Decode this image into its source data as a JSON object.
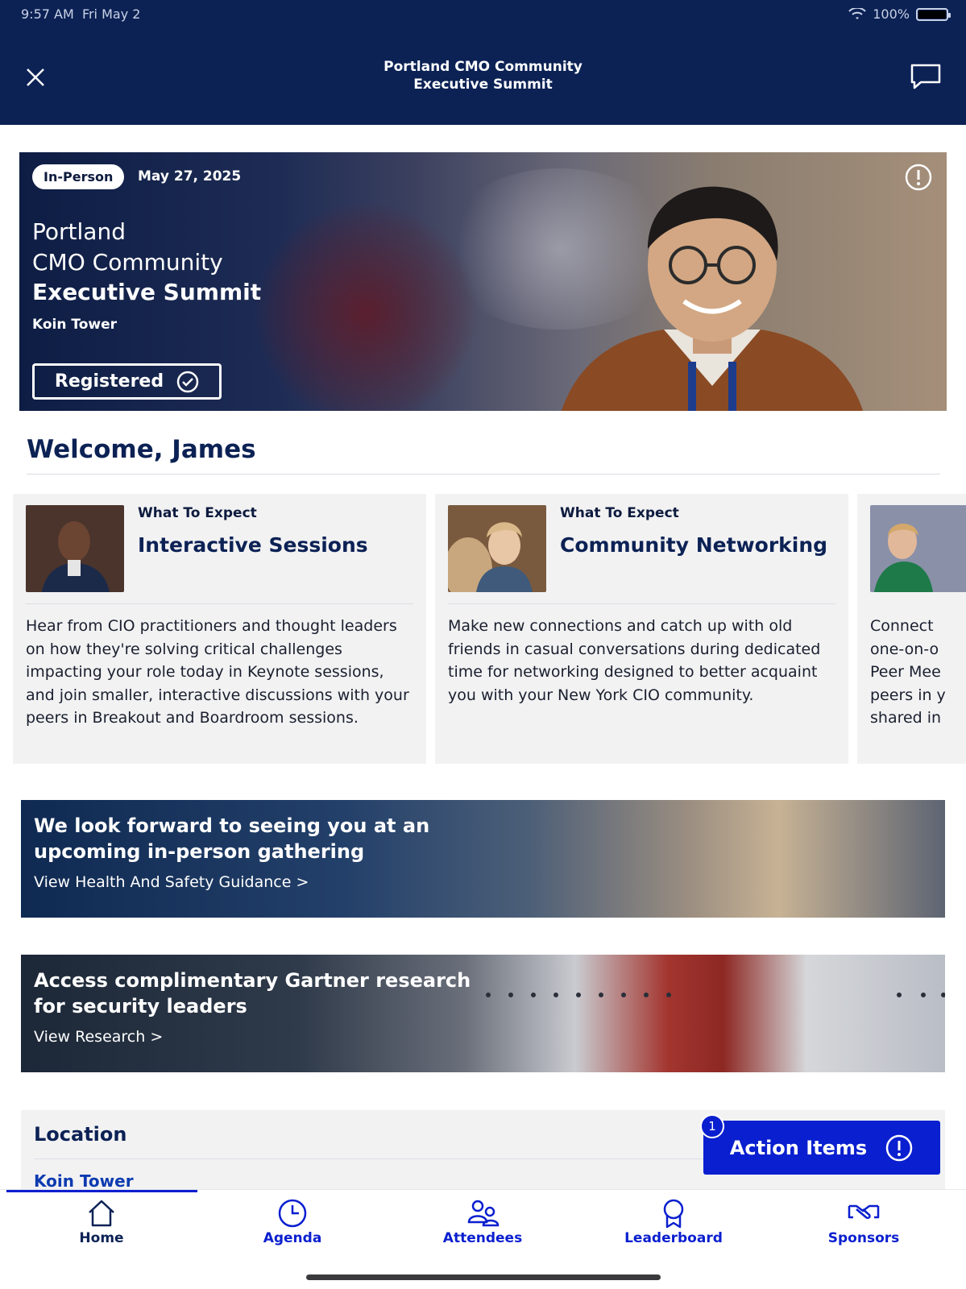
{
  "status_bar": {
    "time": "9:57 AM",
    "date": "Fri May 2",
    "battery": "100%"
  },
  "header": {
    "title_line1": "Portland CMO Community",
    "title_line2": "Executive Summit"
  },
  "hero": {
    "format_chip": "In-Person",
    "date": "May 27, 2025",
    "line1": "Portland",
    "line2": "CMO Community",
    "line3": "Executive Summit",
    "venue": "Koin Tower",
    "registered_label": "Registered"
  },
  "welcome": "Welcome, James",
  "cards": [
    {
      "kicker": "What To Expect",
      "title": "Interactive Sessions",
      "body": "Hear from CIO practitioners and thought leaders on how they're solving critical challenges impacting your role today in Keynote sessions, and join smaller, interactive discussions with your peers in Breakout and Boardroom sessions."
    },
    {
      "kicker": "What To Expect",
      "title": "Community Networking",
      "body": "Make new connections and catch up with old friends in casual conversations during dedicated time for networking designed to better acquaint you with your New York CIO community."
    },
    {
      "kicker": "",
      "title": "",
      "body": "Connect one-on-o Peer Mee peers in y shared in"
    }
  ],
  "banners": [
    {
      "title": "We look forward to seeing you at an upcoming in-person gathering",
      "link": "View Health And Safety Guidance >"
    },
    {
      "title": "Access complimentary Gartner research for security leaders",
      "link": "View Research >"
    }
  ],
  "location": {
    "title": "Location",
    "venue": "Koin Tower"
  },
  "action_items": {
    "label": "Action Items",
    "count": "1"
  },
  "tabs": [
    {
      "label": "Home",
      "icon": "home-icon"
    },
    {
      "label": "Agenda",
      "icon": "clock-icon"
    },
    {
      "label": "Attendees",
      "icon": "people-icon"
    },
    {
      "label": "Leaderboard",
      "icon": "award-icon"
    },
    {
      "label": "Sponsors",
      "icon": "handshake-icon"
    }
  ],
  "colors": {
    "navy": "#0c2255",
    "accent_blue": "#0a1fcf",
    "card_bg": "#f2f2f3"
  }
}
